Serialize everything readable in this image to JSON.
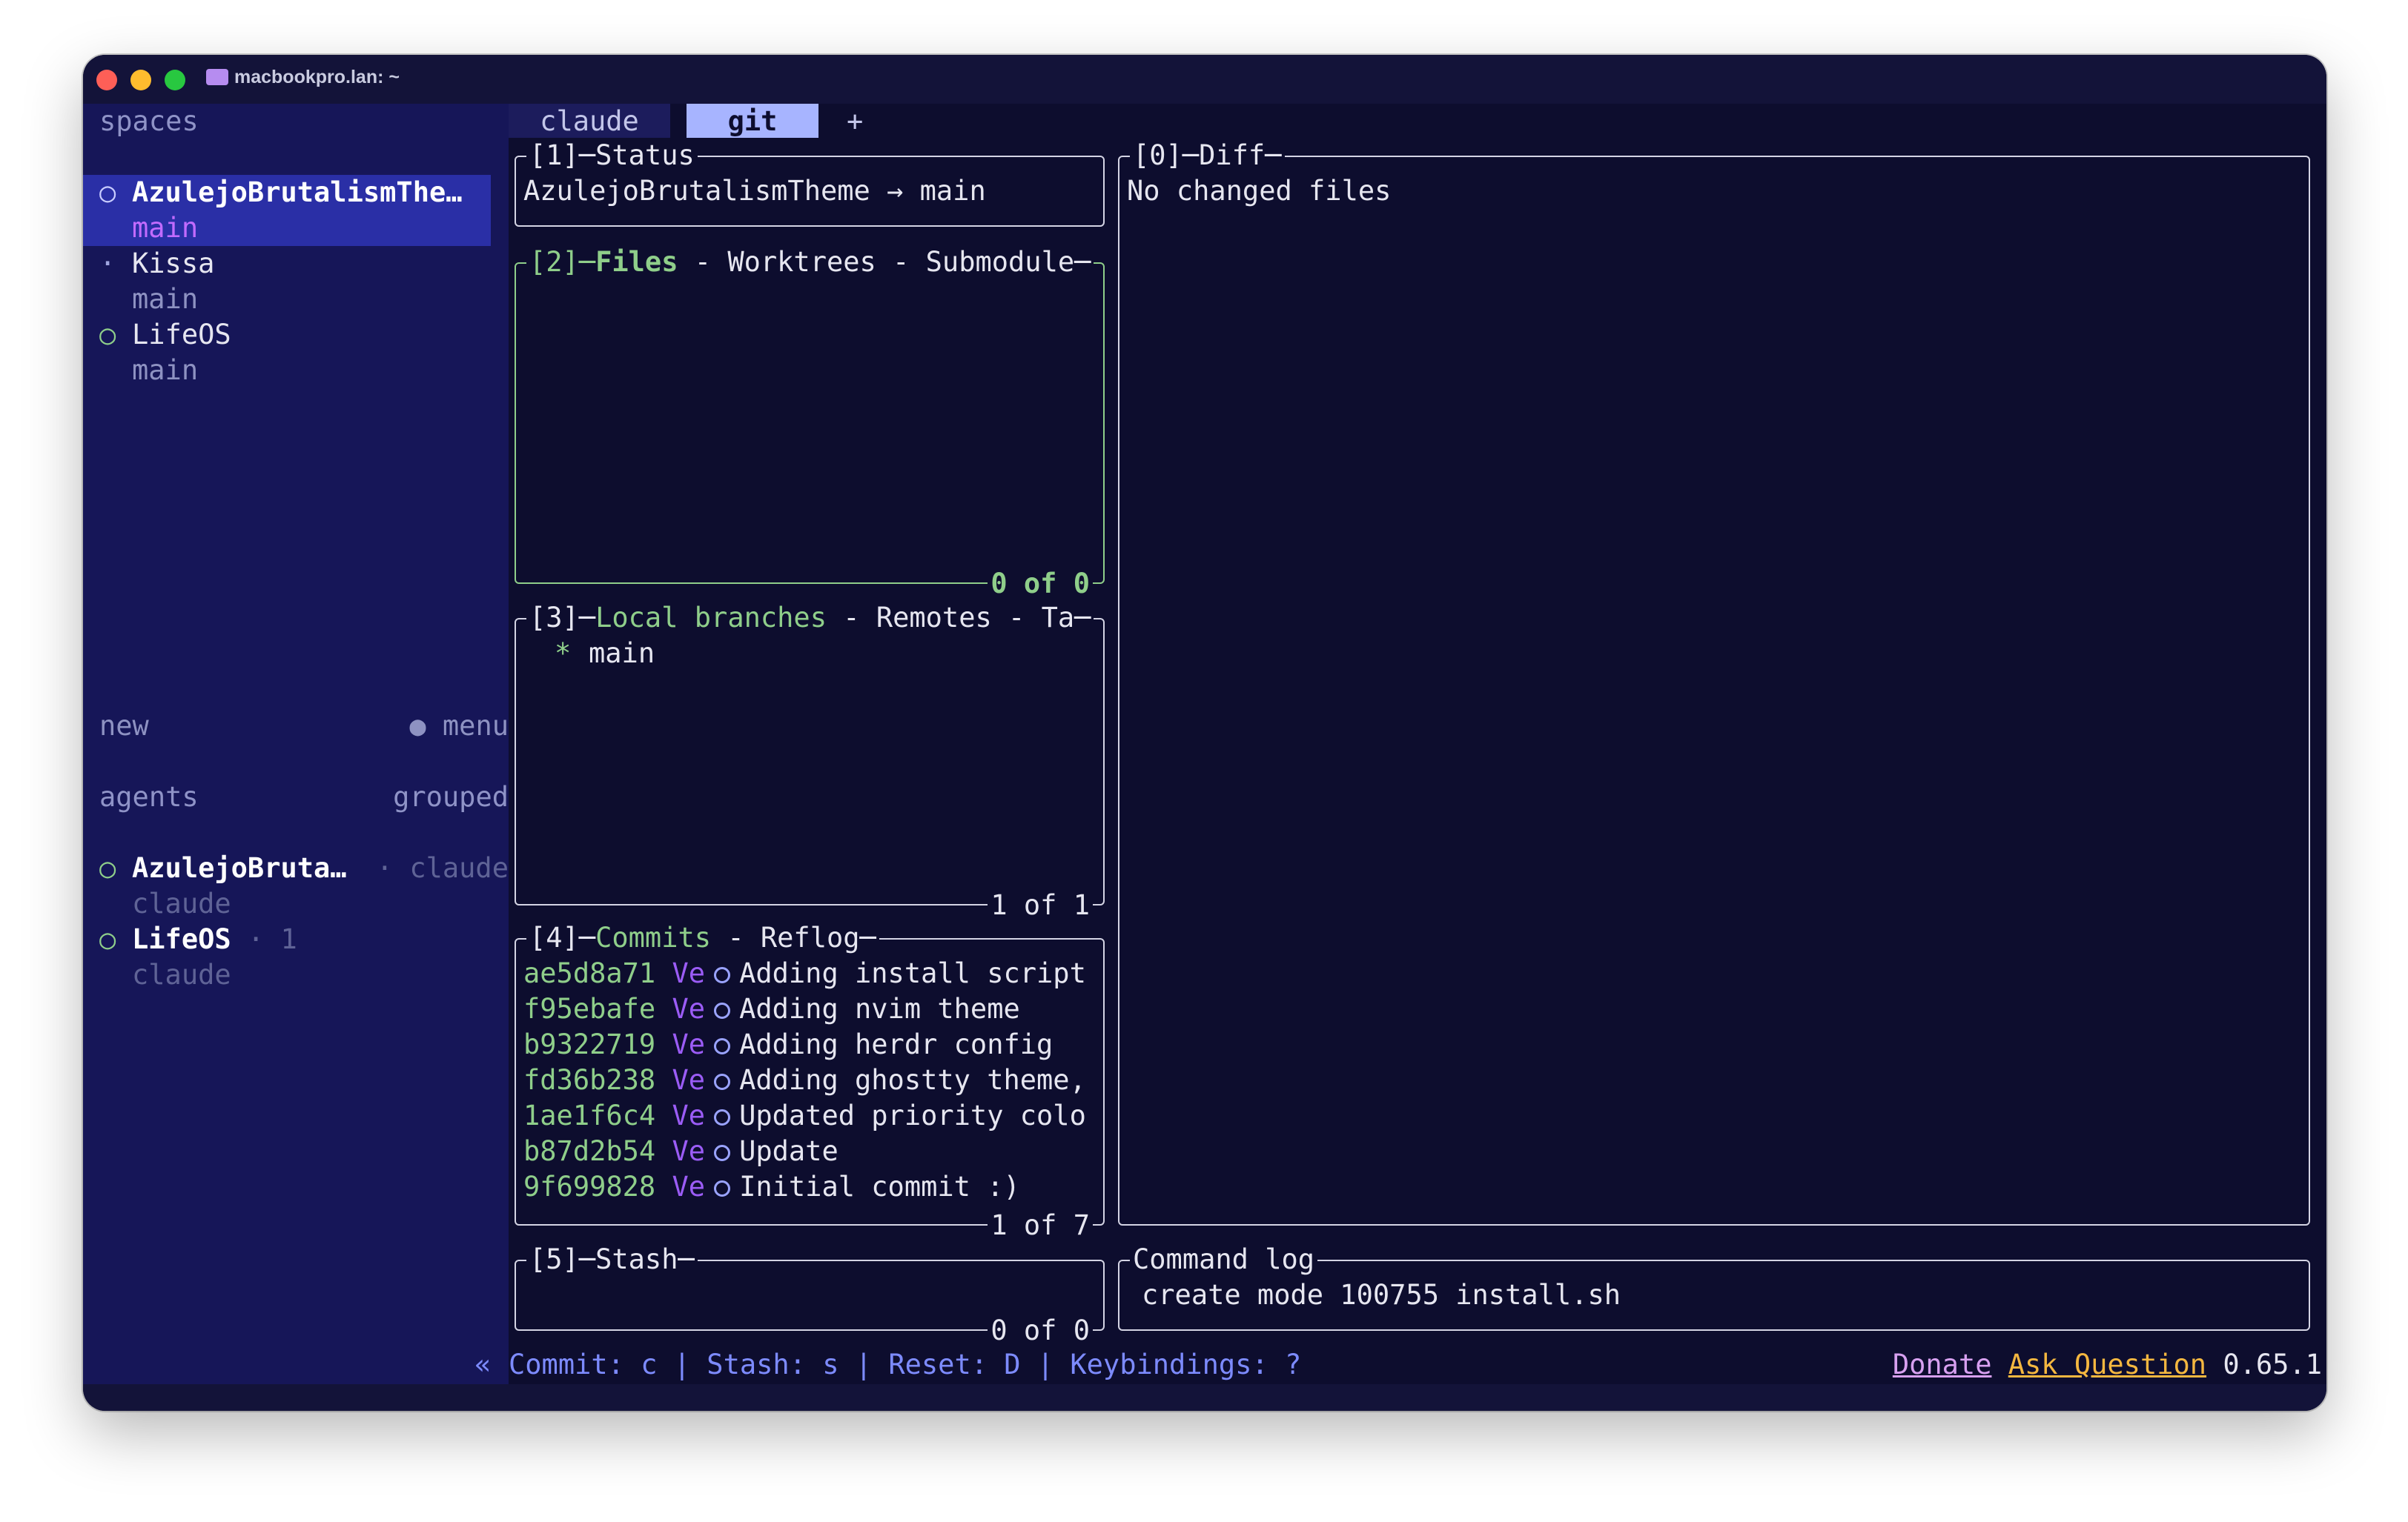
{
  "window": {
    "title": "macbookpro.lan: ~"
  },
  "sidebar": {
    "spaces_header": "spaces",
    "spaces": [
      {
        "name": "AzulejoBrutalismThe…",
        "branch": "main",
        "selected": true,
        "marker": "○"
      },
      {
        "name": "Kissa",
        "branch": "main",
        "selected": false,
        "marker": "·"
      },
      {
        "name": "LifeOS",
        "branch": "main",
        "selected": false,
        "marker": "○"
      }
    ],
    "new_label": "new",
    "menu_label": "● menu",
    "agents_header": "agents",
    "grouped_label": "grouped",
    "agents": [
      {
        "name": "AzulejoBruta…",
        "meta": "· claude",
        "sub": "claude",
        "marker": "○"
      },
      {
        "name": "LifeOS",
        "meta": "· 1",
        "sub": "claude",
        "marker": "○"
      }
    ],
    "collapse_glyph": "«"
  },
  "tabs": [
    {
      "label": "claude",
      "active": false
    },
    {
      "label": "git",
      "active": true
    }
  ],
  "add_tab_glyph": "+",
  "panels": {
    "status": {
      "num": "[1]",
      "title": "Status",
      "line": "AzulejoBrutalismTheme → main"
    },
    "files": {
      "num": "[2]",
      "tabs": [
        "Files",
        "Worktrees",
        "Submodule"
      ],
      "footer": "0 of 0"
    },
    "branches": {
      "num": "[3]",
      "tabs": [
        "Local branches",
        "Remotes",
        "Ta"
      ],
      "items": [
        {
          "marker": "*",
          "name": "main"
        }
      ],
      "footer": "1 of 1"
    },
    "commits": {
      "num": "[4]",
      "tabs": [
        "Commits",
        "Reflog"
      ],
      "footer": "1 of 7",
      "items": [
        {
          "hash": "ae5d8a71",
          "author": "Ve",
          "msg": "Adding install script"
        },
        {
          "hash": "f95ebafe",
          "author": "Ve",
          "msg": "Adding nvim theme"
        },
        {
          "hash": "b9322719",
          "author": "Ve",
          "msg": "Adding herdr config"
        },
        {
          "hash": "fd36b238",
          "author": "Ve",
          "msg": "Adding ghostty theme,"
        },
        {
          "hash": "1ae1f6c4",
          "author": "Ve",
          "msg": "Updated priority colo"
        },
        {
          "hash": "b87d2b54",
          "author": "Ve",
          "msg": "Update"
        },
        {
          "hash": "9f699828",
          "author": "Ve",
          "msg": "Initial commit :)"
        }
      ]
    },
    "stash": {
      "num": "[5]",
      "title": "Stash",
      "footer": "0 of 0"
    },
    "diff": {
      "num": "[0]",
      "title": "Diff",
      "line": "No changed files"
    },
    "command_log": {
      "title": "Command log",
      "line": "create mode 100755 install.sh"
    }
  },
  "statusbar": {
    "keys": "Commit: c | Stash: s | Reset: D | Keybindings: ?",
    "donate": "Donate",
    "ask": "Ask Question",
    "version": "0.65.1"
  },
  "colors": {
    "bg": "#0d0d2e",
    "sidebar": "#161658",
    "selected": "#2a2fa6",
    "green": "#8fce8a",
    "purple": "#9b5cf6",
    "blue": "#7d8bff",
    "donate": "#d7a0f0",
    "ask": "#f4b740",
    "tab_active": "#a7b4ff"
  }
}
